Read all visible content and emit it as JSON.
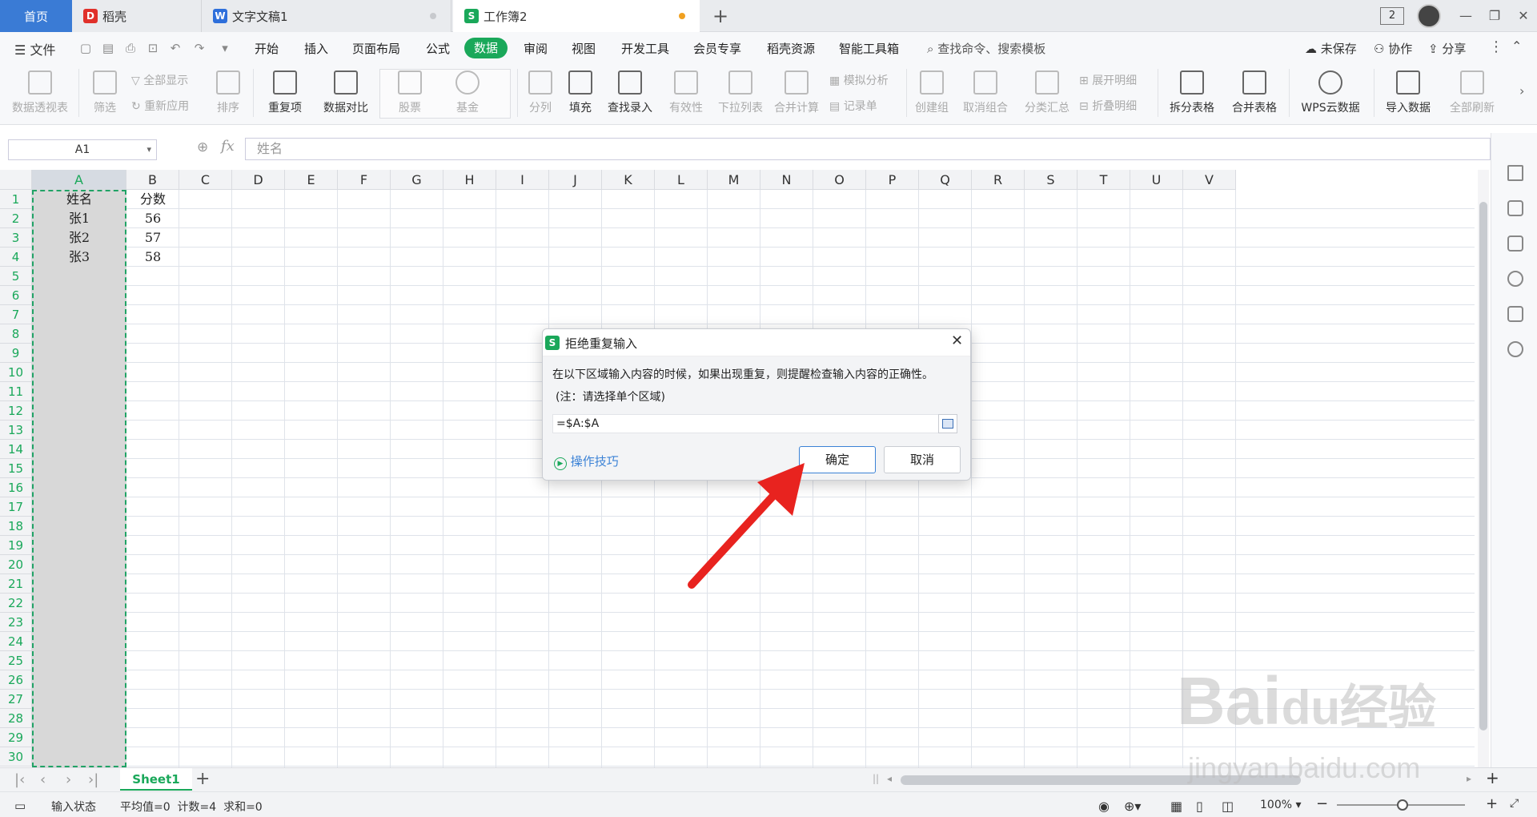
{
  "tabs": {
    "home": "首页",
    "docs": [
      {
        "label": "稻壳",
        "icon_color": "#e0302a"
      },
      {
        "label": "文字文稿1",
        "icon_color": "#2e6fdb"
      },
      {
        "label": "工作簿2",
        "icon_color": "#1aa85a"
      }
    ],
    "new_tab": "+",
    "window_badge": "2"
  },
  "menu": {
    "file": "文件",
    "items": [
      "开始",
      "插入",
      "页面布局",
      "公式",
      "数据",
      "审阅",
      "视图",
      "开发工具",
      "会员专享",
      "稻壳资源",
      "智能工具箱"
    ],
    "active": "数据",
    "search": "查找命令、搜索模板",
    "unsaved": "未保存",
    "collab": "协作",
    "share": "分享"
  },
  "ribbon": {
    "pivot": "数据透视表",
    "filter": "筛选",
    "show_all": "全部显示",
    "reapply": "重新应用",
    "sort": "排序",
    "duplicates": "重复项",
    "compare": "数据对比",
    "stocks": "股票",
    "funds": "基金",
    "split": "分列",
    "fill": "填充",
    "lookup": "查找录入",
    "validity": "有效性",
    "dropdown": "下拉列表",
    "consolidate": "合并计算",
    "whatif": "模拟分析",
    "record": "记录单",
    "group": "创建组",
    "ungroup": "取消组合",
    "subtotal": "分类汇总",
    "expand": "展开明细",
    "collapse": "折叠明细",
    "split_table": "拆分表格",
    "merge_table": "合并表格",
    "cloud": "WPS云数据",
    "import": "导入数据",
    "refresh_all": "全部刷新"
  },
  "formula_bar": {
    "cell_ref": "A1",
    "fx": "fx",
    "content": "姓名"
  },
  "sheet": {
    "columns": [
      "A",
      "B",
      "C",
      "D",
      "E",
      "F",
      "G",
      "H",
      "I",
      "J",
      "K",
      "L",
      "M",
      "N",
      "O",
      "P",
      "Q",
      "R",
      "S",
      "T",
      "U",
      "V"
    ],
    "rows": [
      "1",
      "2",
      "3",
      "4",
      "5",
      "6",
      "7",
      "8",
      "9",
      "10",
      "11",
      "12",
      "13",
      "14",
      "15",
      "16",
      "17",
      "18",
      "19",
      "20",
      "21",
      "22",
      "23",
      "24",
      "25",
      "26",
      "27",
      "28",
      "29",
      "30"
    ],
    "data": [
      [
        "姓名",
        "分数"
      ],
      [
        "张1",
        "56"
      ],
      [
        "张2",
        "57"
      ],
      [
        "张3",
        "58"
      ]
    ],
    "tab": "Sheet1",
    "add_sheet": "+"
  },
  "dialog": {
    "title": "拒绝重复输入",
    "message": "在以下区域输入内容的时候，如果出现重复，则提醒检查输入内容的正确性。",
    "note": "(注：请选择单个区域)",
    "range": "=$A:$A",
    "tips": "操作技巧",
    "ok": "确定",
    "cancel": "取消"
  },
  "status": {
    "mode": "输入状态",
    "summary": "平均值=0  计数=4  求和=0",
    "zoom": "100%"
  },
  "watermark": {
    "brand": "Bai",
    "brand_tail": "经验",
    "url": "jingyan.baidu.com"
  },
  "colors": {
    "accent": "#1aa85a",
    "arrow": "#e8231f",
    "primary_border": "#3b82d6"
  }
}
